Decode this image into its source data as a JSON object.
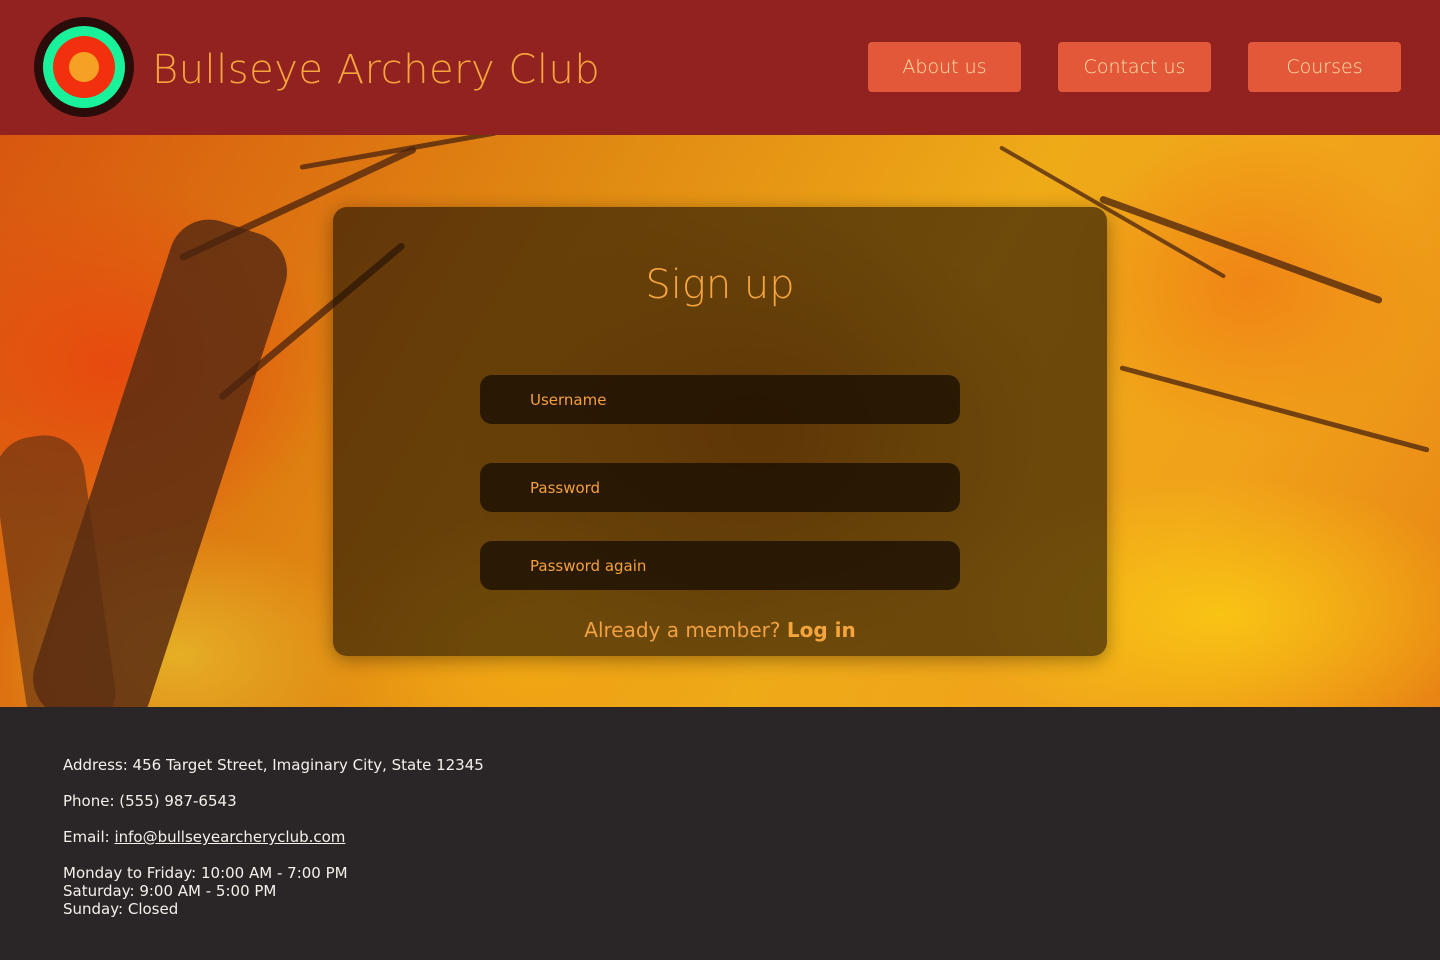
{
  "header": {
    "brand": "Bullseye Archery Club",
    "nav": [
      {
        "label": "About us"
      },
      {
        "label": "Contact us"
      },
      {
        "label": "Courses"
      }
    ]
  },
  "form": {
    "title": "Sign up",
    "username_placeholder": "Username",
    "password_placeholder": "Password",
    "password_again_placeholder": "Password again",
    "already_member": "Already a member?",
    "login_link": "Log in"
  },
  "footer": {
    "address": "Address: 456 Target Street, Imaginary City, State 12345",
    "phone": "Phone: (555) 987-6543",
    "email_label": "Email:",
    "email": "info@bullseyearcheryclub.com",
    "hours": [
      "Monday to Friday: 10:00 AM - 7:00 PM",
      "Saturday: 9:00 AM - 5:00 PM",
      "Sunday: Closed"
    ]
  },
  "colors": {
    "header_bg": "#922220",
    "accent": "#f6a43c",
    "nav_button": "#e4583a",
    "footer_bg": "#2a2627",
    "logo_rings": [
      "#2a0d0a",
      "#19f29a",
      "#f2300e",
      "#f6a123"
    ]
  },
  "icons": {
    "logo": "bullseye-target-icon"
  }
}
